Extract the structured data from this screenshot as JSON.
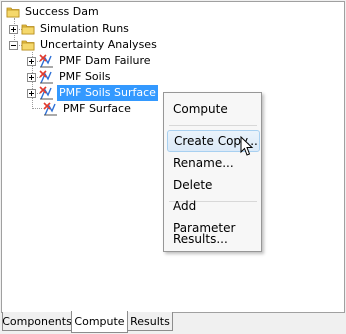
{
  "tree": {
    "root": "Success Dam",
    "simulation_runs": "Simulation Runs",
    "uncertainty_analyses": "Uncertainty Analyses",
    "items": [
      {
        "label": "PMF Dam Failure"
      },
      {
        "label": "PMF Soils"
      },
      {
        "label": "PMF Soils Surface"
      },
      {
        "label": "PMF Surface"
      }
    ]
  },
  "context_menu": {
    "items": [
      "Compute",
      "Create Copy...",
      "Rename...",
      "Delete",
      "Add Parameter",
      "Results..."
    ]
  },
  "tabs": [
    "Components",
    "Compute",
    "Results"
  ],
  "colors": {
    "selection": "#3399ff",
    "folder": "#e8c24a",
    "alternative_icon_red": "#e23b2e",
    "alternative_icon_blue": "#2c6fd6"
  }
}
